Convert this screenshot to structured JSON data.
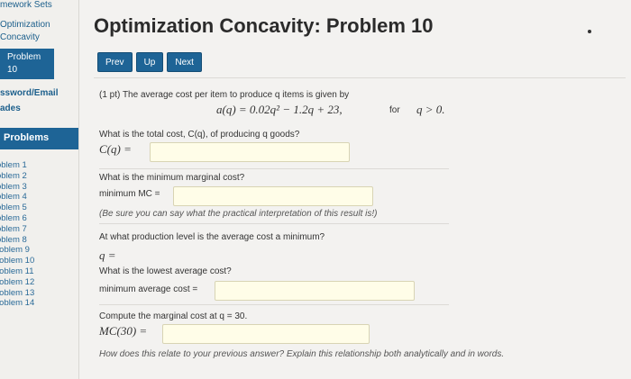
{
  "sidebar": {
    "top_links": [
      "mework Sets",
      "Optimization",
      "Concavity"
    ],
    "current_problem_label": "Problem",
    "current_problem_number": "10",
    "password_email": "ssword/Email",
    "grades": "ades",
    "problems_header": "Problems",
    "problem_items": [
      "oblem 1",
      "oblem 2",
      "oblem 3",
      "oblem 4",
      "oblem 5",
      "oblem 6",
      "oblem 7",
      "oblem 8",
      "roblem 9",
      "roblem 10",
      "roblem 11",
      "roblem 12",
      "roblem 13",
      "roblem 14"
    ]
  },
  "main": {
    "title": "Optimization Concavity: Problem 10",
    "buttons": {
      "prev": "Prev",
      "up": "Up",
      "next": "Next"
    },
    "intro": "(1 pt) The average cost per item to produce q items is given by",
    "formula": "a(q) = 0.02q² − 1.2q + 23,",
    "for_text": "for",
    "condition": "q > 0.",
    "q1_text": "What is the total cost, C(q), of producing q goods?",
    "q1_label": "C(q) =",
    "q2_text": "What is the minimum marginal cost?",
    "q2_label": "minimum MC =",
    "q2_note": "(Be sure you can say what the practical interpretation of this result is!)",
    "q3_text": "At what production level is the average cost a minimum?",
    "q3_label": "q =",
    "q4_text": "What is the lowest average cost?",
    "q4_label": "minimum average cost =",
    "q5_text": "Compute the marginal cost at q = 30.",
    "q5_label": "MC(30) =",
    "q5_note": "How does this relate to your previous answer? Explain this relationship both analytically and in words."
  }
}
